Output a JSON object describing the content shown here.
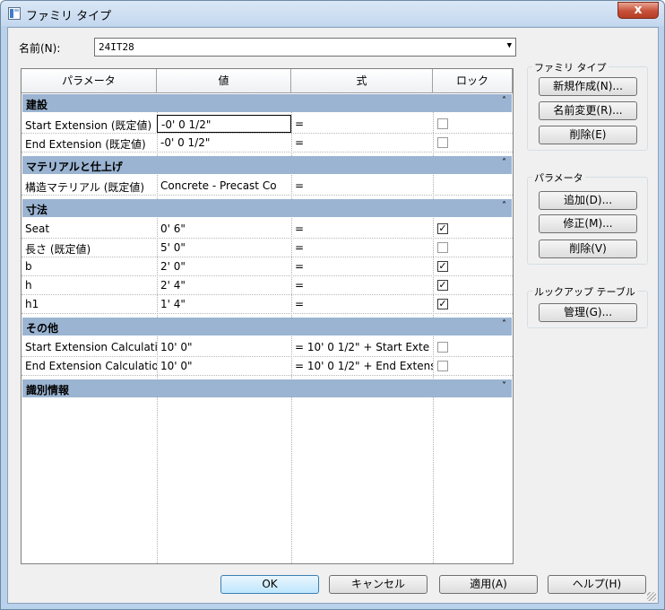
{
  "window": {
    "title": "ファミリ タイプ",
    "close_label": "x"
  },
  "name_field": {
    "label": "名前(N):",
    "value": "24IT28"
  },
  "grid": {
    "headers": [
      "パラメータ",
      "値",
      "式",
      "ロック"
    ],
    "groups": [
      {
        "label": "建設",
        "chevron": "˄",
        "rows": [
          {
            "param": "Start Extension (既定値)",
            "value": "-0'  0 1/2\"",
            "formula": "=",
            "lock": "off",
            "editing": true
          },
          {
            "param": "End Extension (既定値)",
            "value": "-0'  0 1/2\"",
            "formula": "=",
            "lock": "off"
          }
        ]
      },
      {
        "label": "マテリアルと仕上げ",
        "chevron": "˄",
        "rows": [
          {
            "param": "構造マテリアル (既定値)",
            "value": "Concrete - Precast Co",
            "formula": "=",
            "lock": "none"
          }
        ]
      },
      {
        "label": "寸法",
        "chevron": "˄",
        "rows": [
          {
            "param": "Seat",
            "value": "0'  6\"",
            "formula": "=",
            "lock": "on"
          },
          {
            "param": "長さ (既定値)",
            "value": "5'  0\"",
            "formula": "=",
            "lock": "off"
          },
          {
            "param": "b",
            "value": "2'  0\"",
            "formula": "=",
            "lock": "on"
          },
          {
            "param": "h",
            "value": "2'  4\"",
            "formula": "=",
            "lock": "on"
          },
          {
            "param": "h1",
            "value": "1'  4\"",
            "formula": "=",
            "lock": "on"
          }
        ]
      },
      {
        "label": "その他",
        "chevron": "˄",
        "rows": [
          {
            "param": "Start Extension Calculati",
            "value": "10'  0\"",
            "formula": "= 10'  0 1/2\" + Start Exte",
            "lock": "off"
          },
          {
            "param": "End Extension Calculatio",
            "value": "10'  0\"",
            "formula": "= 10'  0 1/2\" + End Extens",
            "lock": "off"
          }
        ]
      },
      {
        "label": "識別情報",
        "chevron": "˅",
        "rows": []
      }
    ]
  },
  "side": {
    "family_types": {
      "title": "ファミリ タイプ",
      "new": "新規作成(N)...",
      "rename": "名前変更(R)...",
      "delete": "削除(E)"
    },
    "parameters": {
      "title": "パラメータ",
      "add": "追加(D)...",
      "modify": "修正(M)...",
      "remove": "削除(V)"
    },
    "lookup": {
      "title": "ルックアップ テーブル",
      "manage": "管理(G)..."
    }
  },
  "footer": {
    "ok": "OK",
    "cancel": "キャンセル",
    "apply": "適用(A)",
    "help": "ヘルプ(H)"
  },
  "check_glyph": "✓"
}
